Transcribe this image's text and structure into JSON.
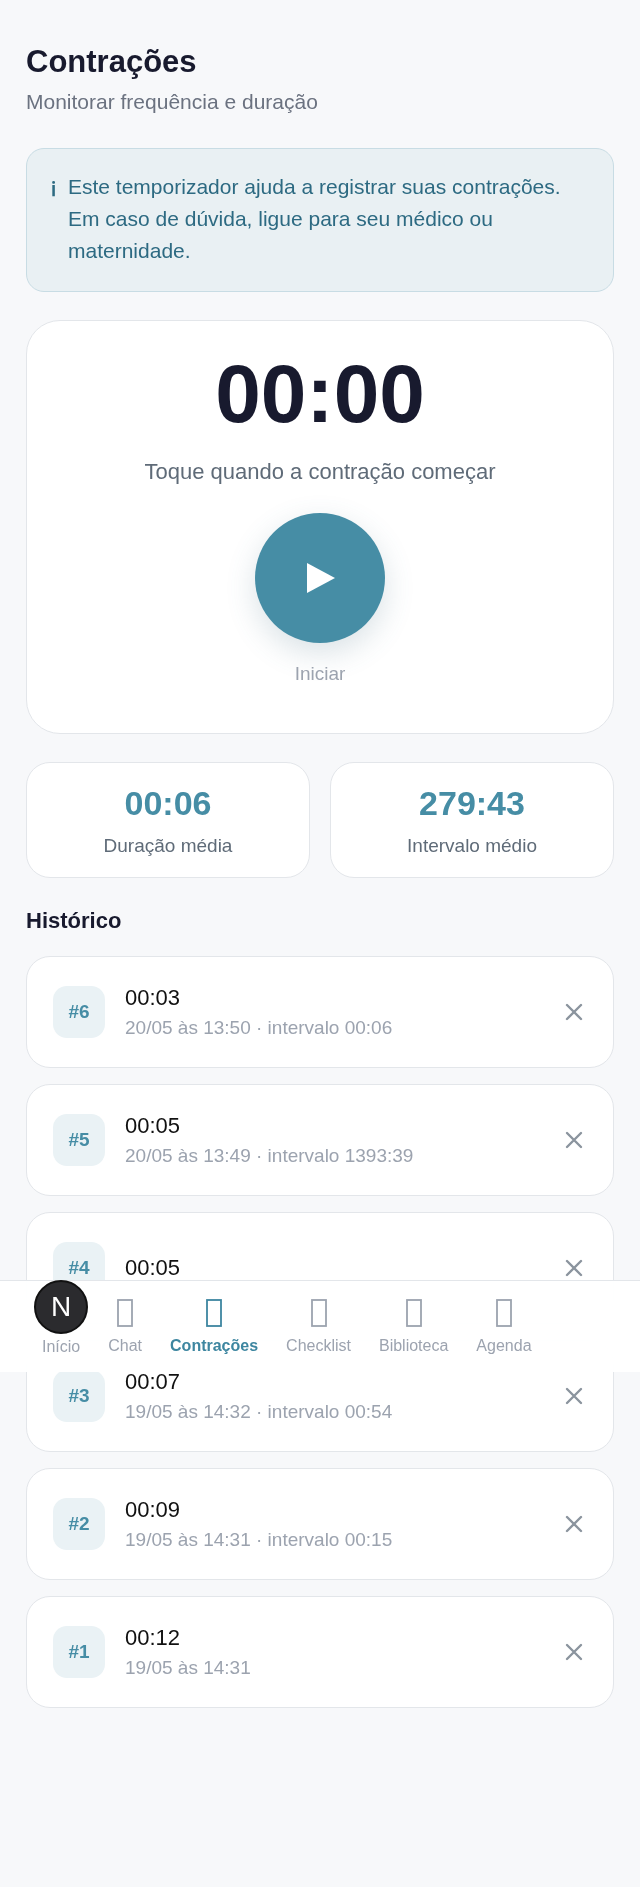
{
  "header": {
    "title": "Contrações",
    "subtitle": "Monitorar frequência e duração"
  },
  "info": {
    "icon": "ℹ",
    "text": "Este temporizador ajuda a registrar suas contrações. Em caso de dúvida, ligue para seu médico ou maternidade."
  },
  "timer": {
    "time": "00:00",
    "hint": "Toque quando a contração começar",
    "button_label": "Iniciar"
  },
  "stats": [
    {
      "value": "00:06",
      "label": "Duração média"
    },
    {
      "value": "279:43",
      "label": "Intervalo médio"
    }
  ],
  "history": {
    "title": "Histórico",
    "items": [
      {
        "number": "#6",
        "duration": "00:03",
        "detail": "20/05 às 13:50 · intervalo 00:06"
      },
      {
        "number": "#5",
        "duration": "00:05",
        "detail": "20/05 às 13:49 · intervalo 1393:39"
      },
      {
        "number": "#4",
        "duration": "00:05"
      },
      {
        "number": "#3",
        "duration": "00:07",
        "detail": "19/05 às 14:32 · intervalo 00:54"
      },
      {
        "number": "#2",
        "duration": "00:09",
        "detail": "19/05 às 14:31 · intervalo 00:15"
      },
      {
        "number": "#1",
        "duration": "00:12",
        "detail": "19/05 às 14:31"
      }
    ]
  },
  "nav": [
    {
      "label": "Início",
      "selected": false,
      "under_badge": true
    },
    {
      "label": "Chat",
      "selected": false,
      "under_badge": false
    },
    {
      "label": "Contrações",
      "selected": true,
      "under_badge": false
    },
    {
      "label": "Checklist",
      "selected": false,
      "under_badge": false
    },
    {
      "label": "Biblioteca",
      "selected": false,
      "under_badge": false
    },
    {
      "label": "Agenda",
      "selected": false,
      "under_badge": false
    }
  ],
  "dev_badge": {
    "letter": "N"
  }
}
